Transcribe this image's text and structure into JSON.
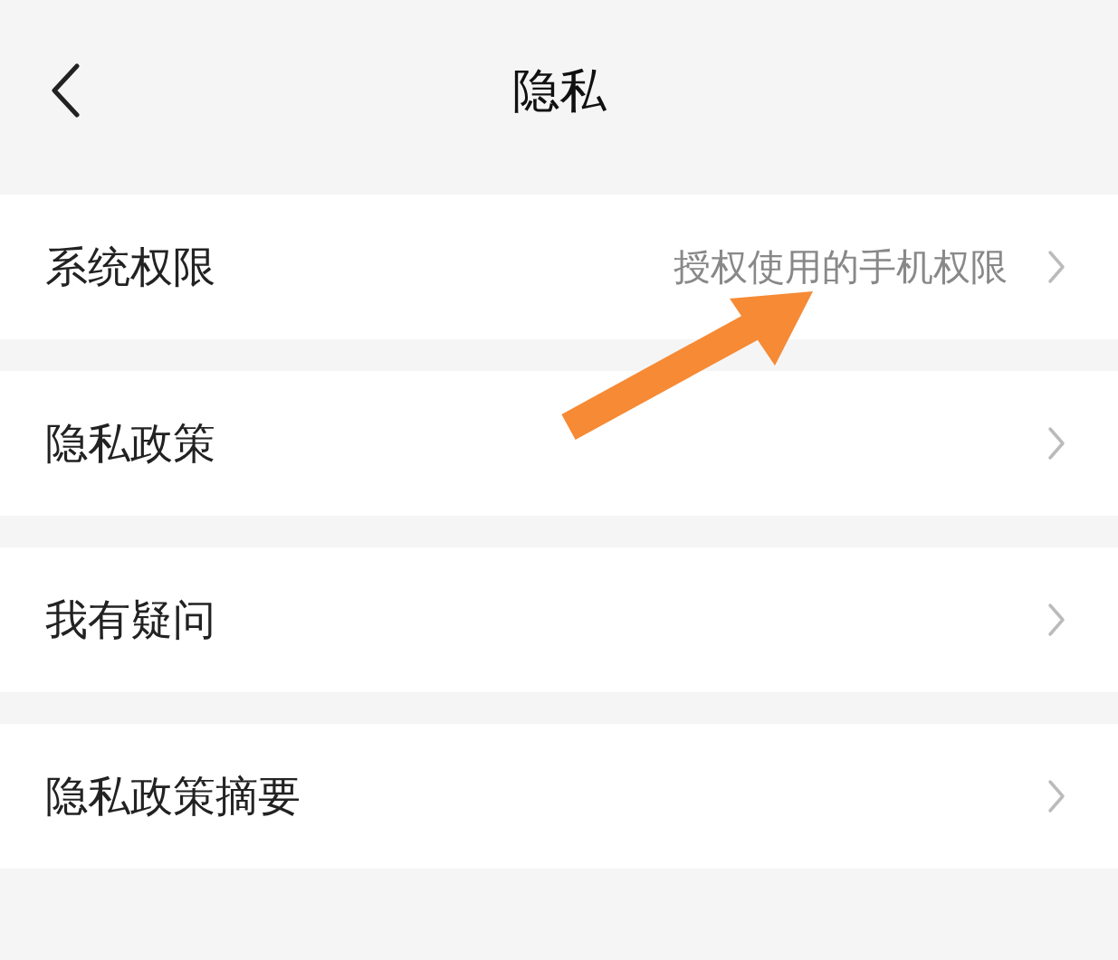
{
  "header": {
    "title": "隐私"
  },
  "rows": [
    {
      "label": "系统权限",
      "detail": "授权使用的手机权限"
    },
    {
      "label": "隐私政策"
    },
    {
      "label": "我有疑问"
    },
    {
      "label": "隐私政策摘要"
    }
  ],
  "annotation": {
    "kind": "arrow"
  }
}
